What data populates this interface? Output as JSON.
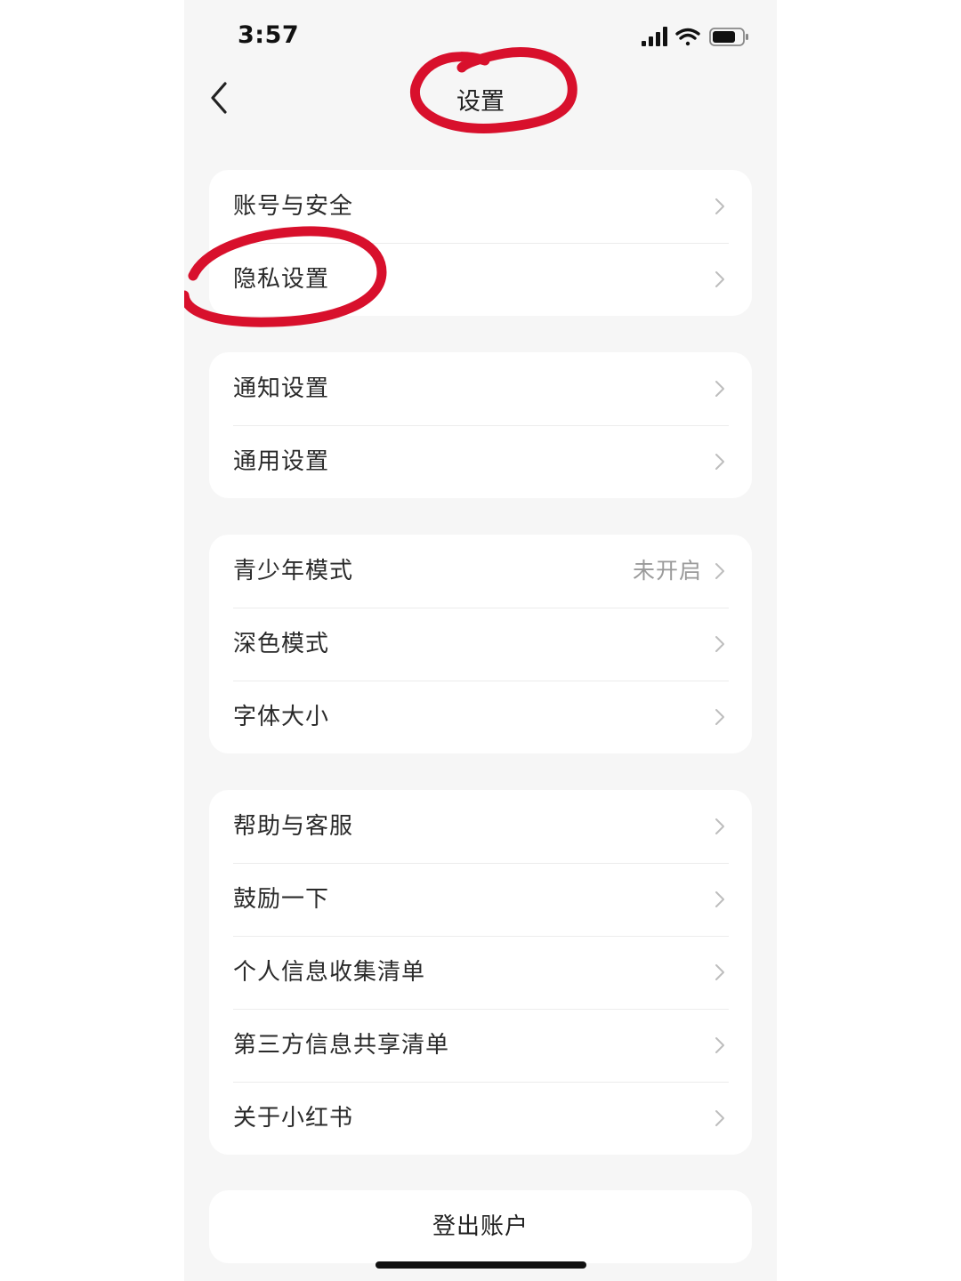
{
  "status_bar": {
    "time": "3:57",
    "icons": [
      "signal-icon",
      "wifi-icon",
      "battery-icon"
    ]
  },
  "nav": {
    "back_icon": "chevron-left-icon",
    "title": "设置"
  },
  "groups": [
    {
      "items": [
        {
          "label": "账号与安全"
        },
        {
          "label": "隐私设置"
        }
      ]
    },
    {
      "items": [
        {
          "label": "通知设置"
        },
        {
          "label": "通用设置"
        }
      ]
    },
    {
      "items": [
        {
          "label": "青少年模式",
          "value": "未开启"
        },
        {
          "label": "深色模式"
        },
        {
          "label": "字体大小"
        }
      ]
    },
    {
      "items": [
        {
          "label": "帮助与客服"
        },
        {
          "label": "鼓励一下"
        },
        {
          "label": "个人信息收集清单"
        },
        {
          "label": "第三方信息共享清单"
        },
        {
          "label": "关于小红书"
        }
      ]
    }
  ],
  "logout_label": "登出账户",
  "colors": {
    "page_background": "#f6f6f6",
    "card_background": "#ffffff",
    "annotation_red": "#d8102c",
    "secondary_text": "#9a9a9a"
  },
  "annotations": [
    {
      "type": "hand-drawn-circle",
      "target": "nav.title"
    },
    {
      "type": "hand-drawn-circle",
      "target": "groups.0.items.1.label"
    }
  ]
}
